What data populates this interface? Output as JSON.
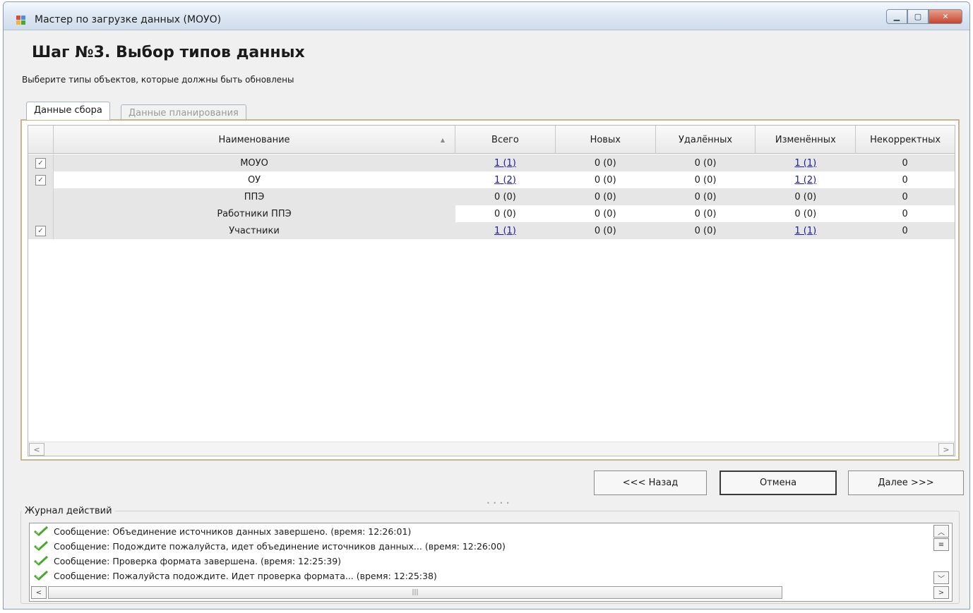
{
  "window": {
    "title": "Мастер по загрузке данных (МОУО)",
    "controls": [
      "minimize-icon",
      "maximize-icon",
      "close-icon"
    ]
  },
  "step": {
    "title": "Шаг №3.  Выбор типов данных",
    "subtitle": "Выберите типы объектов, которые должны быть обновлены"
  },
  "tabs": [
    {
      "label": "Данные сбора",
      "active": true
    },
    {
      "label": "Данные планирования",
      "active": false
    }
  ],
  "grid": {
    "columns": [
      "Наименование",
      "Всего",
      "Новых",
      "Удалённых",
      "Изменённых",
      "Некорректных"
    ],
    "sort_icon": "sort-ascending-icon",
    "rows": [
      {
        "checked": true,
        "has_checkbox": true,
        "name": "МОУО",
        "total": "1 (1)",
        "new": "0 (0)",
        "deleted": "0 (0)",
        "changed": "1 (1)",
        "incorrect": "0",
        "total_link": true,
        "changed_link": true
      },
      {
        "checked": true,
        "has_checkbox": true,
        "name": "ОУ",
        "total": "1 (2)",
        "new": "0 (0)",
        "deleted": "0 (0)",
        "changed": "1 (2)",
        "incorrect": "0",
        "total_link": true,
        "changed_link": true
      },
      {
        "checked": false,
        "has_checkbox": false,
        "name": "ППЭ",
        "total": "0 (0)",
        "new": "0 (0)",
        "deleted": "0 (0)",
        "changed": "0 (0)",
        "incorrect": "0",
        "total_link": false,
        "changed_link": false
      },
      {
        "checked": false,
        "has_checkbox": false,
        "name": "Работники ППЭ",
        "total": "0 (0)",
        "new": "0 (0)",
        "deleted": "0 (0)",
        "changed": "0 (0)",
        "incorrect": "0",
        "total_link": false,
        "changed_link": false
      },
      {
        "checked": true,
        "has_checkbox": true,
        "name": "Участники",
        "total": "1 (1)",
        "new": "0 (0)",
        "deleted": "0 (0)",
        "changed": "1 (1)",
        "incorrect": "0",
        "total_link": true,
        "changed_link": true
      }
    ]
  },
  "buttons": {
    "back": "<<< Назад",
    "cancel": "Отмена",
    "next": "Далее >>>"
  },
  "log": {
    "title": "Журнал действий",
    "entries": [
      "Сообщение: Объединение источников данных завершено. (время: 12:26:01)",
      "Сообщение: Подождите пожалуйста, идет объединение источников данных... (время: 12:26:00)",
      "Сообщение: Проверка формата завершена. (время: 12:25:39)",
      "Сообщение: Пожалуйста подождите. Идет проверка формата... (время: 12:25:38)"
    ],
    "entry_icon": "success-check-icon"
  },
  "colors": {
    "link": "#1a1aa6",
    "check_green": "#4aa82c",
    "panel_border": "#c9b48c",
    "alt_row": "#e6e6e6"
  }
}
